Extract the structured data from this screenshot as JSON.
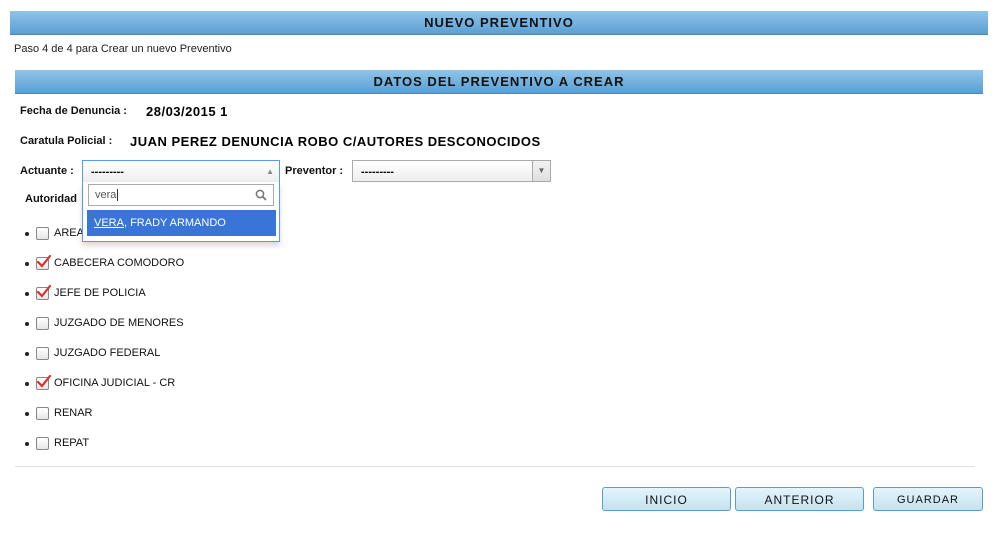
{
  "header": {
    "title": "NUEVO PREVENTIVO"
  },
  "step_text": "Paso 4 de 4 para Crear un nuevo Preventivo",
  "section": {
    "title": "DATOS DEL PREVENTIVO A CREAR"
  },
  "fecha": {
    "label": "Fecha de Denuncia :",
    "value": "28/03/2015 1"
  },
  "caratula": {
    "label": "Caratula Policial :",
    "value": "JUAN PEREZ DENUNCIA ROBO C/AUTORES DESCONOCIDOS"
  },
  "actuante": {
    "label": "Actuante :",
    "selected": "---------",
    "search_value": "vera",
    "result_match": "VERA",
    "result_rest": ", FRADY ARMANDO"
  },
  "preventor": {
    "label": "Preventor :",
    "selected": "---------"
  },
  "autoridades": {
    "label": "Autoridad",
    "items": [
      {
        "label": "AREA",
        "checked": false
      },
      {
        "label": "CABECERA COMODORO",
        "checked": true
      },
      {
        "label": "JEFE DE POLICIA",
        "checked": true
      },
      {
        "label": "JUZGADO DE MENORES",
        "checked": false
      },
      {
        "label": "JUZGADO FEDERAL",
        "checked": false
      },
      {
        "label": "OFICINA JUDICIAL - CR",
        "checked": true
      },
      {
        "label": "RENAR",
        "checked": false
      },
      {
        "label": "REPAT",
        "checked": false
      }
    ]
  },
  "buttons": {
    "inicio": "INICIO",
    "anterior": "ANTERIOR",
    "guardar": "GUARDAR"
  },
  "colors": {
    "header_bar": "#6aaee0",
    "highlight": "#3875d7",
    "button_bg": "#c3e3f1",
    "check": "#d9302c"
  }
}
